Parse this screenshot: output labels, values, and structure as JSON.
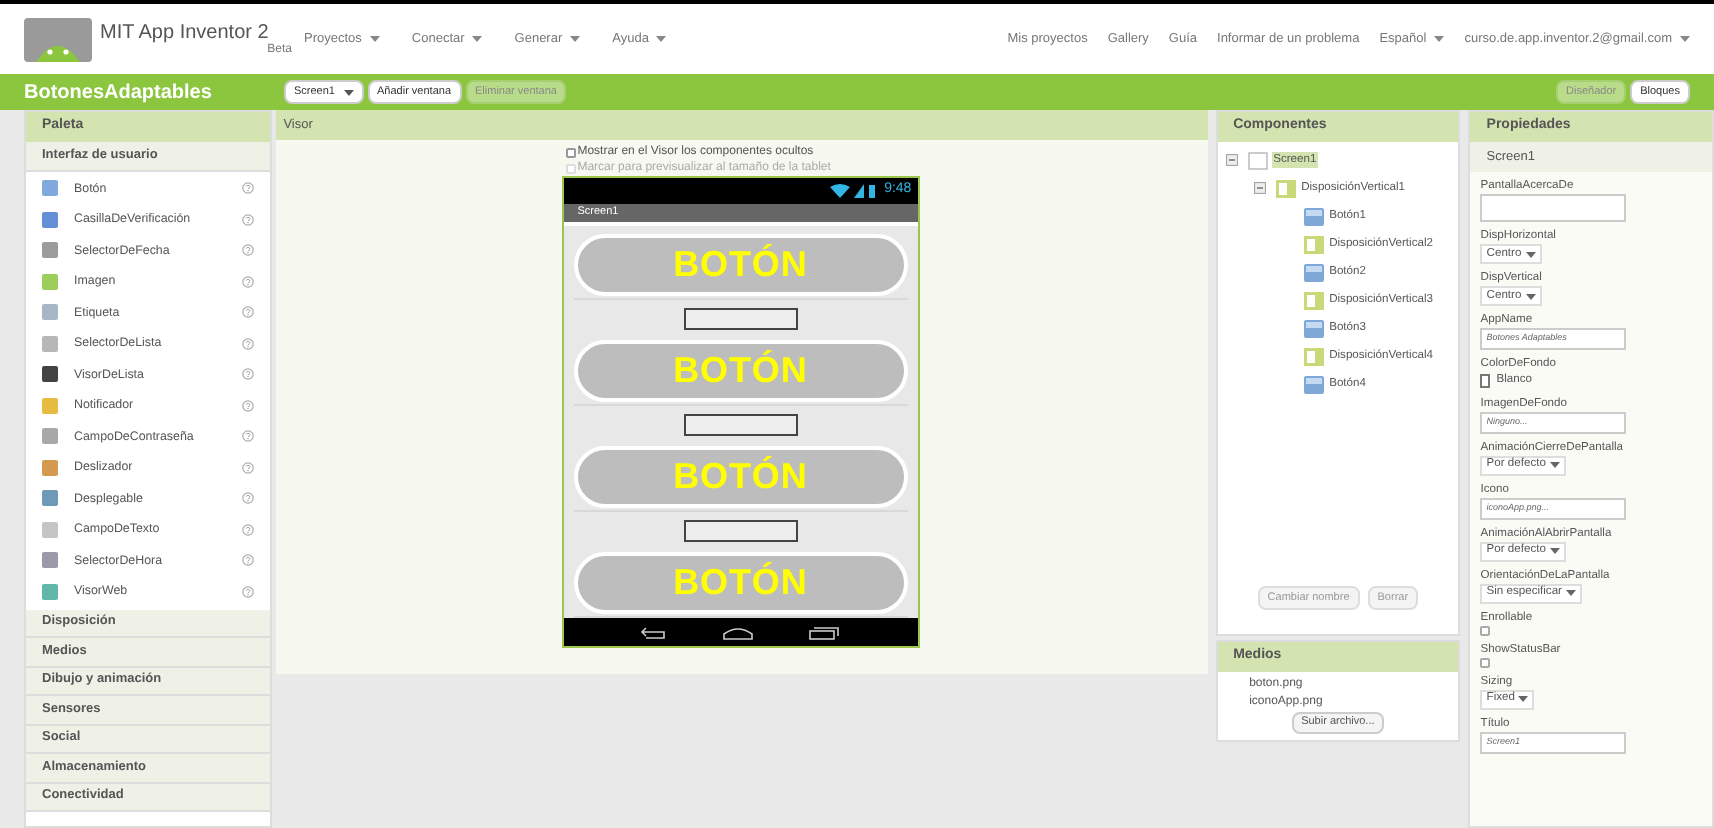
{
  "header": {
    "title": "MIT App Inventor 2",
    "subtitle": "Beta",
    "menus": [
      {
        "label": "Proyectos",
        "dropdown": true
      },
      {
        "label": "Conectar",
        "dropdown": true
      },
      {
        "label": "Generar",
        "dropdown": true
      },
      {
        "label": "Ayuda",
        "dropdown": true
      }
    ],
    "links": [
      {
        "label": "Mis proyectos",
        "dropdown": false
      },
      {
        "label": "Gallery",
        "dropdown": false
      },
      {
        "label": "Guía",
        "dropdown": false
      },
      {
        "label": "Informar de un problema",
        "dropdown": false
      },
      {
        "label": "Español",
        "dropdown": true
      },
      {
        "label": "curso.de.app.inventor.2@gmail.com",
        "dropdown": true
      }
    ]
  },
  "toolbar": {
    "project": "BotonesAdaptables",
    "buttons": [
      {
        "label": "Screen1",
        "dropdown": true,
        "disabled": false
      },
      {
        "label": "Añadir ventana",
        "dropdown": false,
        "disabled": false
      },
      {
        "label": "Eliminar ventana",
        "dropdown": false,
        "disabled": true
      }
    ],
    "modes": [
      {
        "label": "Diseñador",
        "selected": true
      },
      {
        "label": "Bloques",
        "selected": false
      }
    ]
  },
  "palette": {
    "title": "Paleta",
    "categories": [
      {
        "label": "Interfaz de usuario",
        "items": [
          "Botón",
          "CasillaDeVerificación",
          "SelectorDeFecha",
          "Imagen",
          "Etiqueta",
          "SelectorDeLista",
          "VisorDeLista",
          "Notificador",
          "CampoDeContraseña",
          "Deslizador",
          "Desplegable",
          "CampoDeTexto",
          "SelectorDeHora",
          "VisorWeb"
        ]
      },
      {
        "label": "Disposición"
      },
      {
        "label": "Medios"
      },
      {
        "label": "Dibujo y animación"
      },
      {
        "label": "Sensores"
      },
      {
        "label": "Social"
      },
      {
        "label": "Almacenamiento"
      },
      {
        "label": "Conectividad"
      }
    ]
  },
  "viewer": {
    "title": "Visor",
    "options": [
      {
        "label": "Mostrar en el Visor los componentes ocultos",
        "checked": false,
        "disabled": false
      },
      {
        "label": "Marcar para previsualizar al tamaño de la tablet",
        "checked": false,
        "disabled": true
      }
    ],
    "phone": {
      "time": "9:48",
      "screen_title": "Screen1",
      "contents": [
        {
          "kind": "button",
          "label": "BOTÓN"
        },
        {
          "kind": "layout"
        },
        {
          "kind": "button",
          "label": "BOTÓN"
        },
        {
          "kind": "layout"
        },
        {
          "kind": "button",
          "label": "BOTÓN"
        },
        {
          "kind": "layout"
        },
        {
          "kind": "button",
          "label": "BOTÓN"
        }
      ]
    }
  },
  "components": {
    "title": "Componentes",
    "tree": [
      {
        "label": "Screen1",
        "kind": "screen",
        "selected": true,
        "expanded": true,
        "children": [
          {
            "label": "DisposiciónVertical1",
            "kind": "layout",
            "selected": false,
            "expanded": true,
            "children": [
              {
                "label": "Botón1",
                "kind": "button",
                "selected": false
              },
              {
                "label": "DisposiciónVertical2",
                "kind": "layout",
                "selected": false
              },
              {
                "label": "Botón2",
                "kind": "button",
                "selected": false
              },
              {
                "label": "DisposiciónVertical3",
                "kind": "layout",
                "selected": false
              },
              {
                "label": "Botón3",
                "kind": "button",
                "selected": false
              },
              {
                "label": "DisposiciónVertical4",
                "kind": "layout",
                "selected": false
              },
              {
                "label": "Botón4",
                "kind": "button",
                "selected": false
              }
            ]
          }
        ]
      }
    ],
    "buttons": [
      "Cambiar nombre",
      "Borrar"
    ]
  },
  "media": {
    "title": "Medios",
    "files": [
      "boton.png",
      "iconoApp.png"
    ],
    "upload": "Subir archivo..."
  },
  "properties": {
    "title": "Propiedades",
    "component": "Screen1",
    "items": [
      {
        "name": "PantallaAcercaDe",
        "kind": "textarea"
      },
      {
        "name": "DispHorizontal",
        "kind": "dropdown",
        "value": "Centro"
      },
      {
        "name": "DispVertical",
        "kind": "dropdown",
        "value": "Centro"
      },
      {
        "name": "AppName",
        "kind": "text",
        "value": "Botones Adaptables"
      },
      {
        "name": "ColorDeFondo",
        "kind": "color",
        "value": "Blanco",
        "color": "#ffffff"
      },
      {
        "name": "ImagenDeFondo",
        "kind": "text",
        "value": "Ninguno..."
      },
      {
        "name": "AnimaciónCierreDePantalla",
        "kind": "dropdown",
        "value": "Por defecto"
      },
      {
        "name": "Icono",
        "kind": "text",
        "value": "iconoApp.png..."
      },
      {
        "name": "AnimaciónAlAbrirPantalla",
        "kind": "dropdown",
        "value": "Por defecto"
      },
      {
        "name": "OrientaciónDeLaPantalla",
        "kind": "dropdown",
        "value": "Sin especificar"
      },
      {
        "name": "Enrollable",
        "kind": "checkbox",
        "checked": false
      },
      {
        "name": "ShowStatusBar",
        "kind": "checkbox",
        "checked": false
      },
      {
        "name": "Sizing",
        "kind": "dropdown",
        "value": "Fixed"
      },
      {
        "name": "Título",
        "kind": "text",
        "value": "Screen1"
      }
    ]
  }
}
